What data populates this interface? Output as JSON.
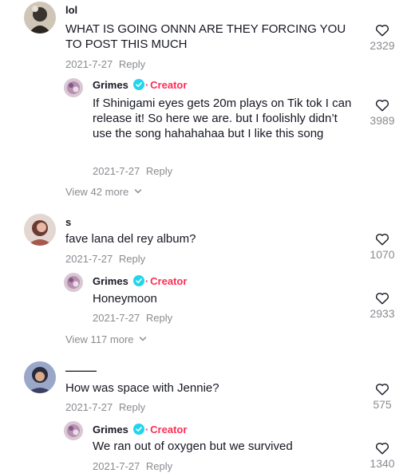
{
  "comments": [
    {
      "username": "lol",
      "text": "WHAT IS GOING ONNN ARE THEY FORCING YOU TO POST THIS MUCH",
      "date": "2021-7-27",
      "reply_label": "Reply",
      "likes": "2329",
      "reply": {
        "username": "Grimes",
        "badge": "Creator",
        "text": "If Shinigami eyes gets 20m plays on Tik tok I can release it! So here we are. but I foolishly didn’t use the song hahahahaa but I like this song",
        "date": "2021-7-27",
        "reply_label": "Reply",
        "likes": "3989"
      },
      "view_more": "View 42 more"
    },
    {
      "username": "s",
      "text": "fave lana del rey album?",
      "date": "2021-7-27",
      "reply_label": "Reply",
      "likes": "1070",
      "reply": {
        "username": "Grimes",
        "badge": "Creator",
        "text": "Honeymoon",
        "date": "2021-7-27",
        "reply_label": "Reply",
        "likes": "2933"
      },
      "view_more": "View 117 more"
    },
    {
      "username": "———",
      "text": "How was space with Jennie?",
      "date": "2021-7-27",
      "reply_label": "Reply",
      "likes": "575",
      "reply": {
        "username": "Grimes",
        "badge": "Creator",
        "text": "We ran out of oxygen but we survived",
        "date": "2021-7-27",
        "reply_label": "Reply",
        "likes": "1340"
      }
    }
  ],
  "icons": {
    "like": "heart-outline-icon",
    "verified": "verified-badge-icon",
    "expand": "chevron-down-icon"
  },
  "colors": {
    "text": "#161823",
    "secondary": "#8a8b91",
    "creator": "#fe2c55",
    "verified": "#20d5ec"
  }
}
